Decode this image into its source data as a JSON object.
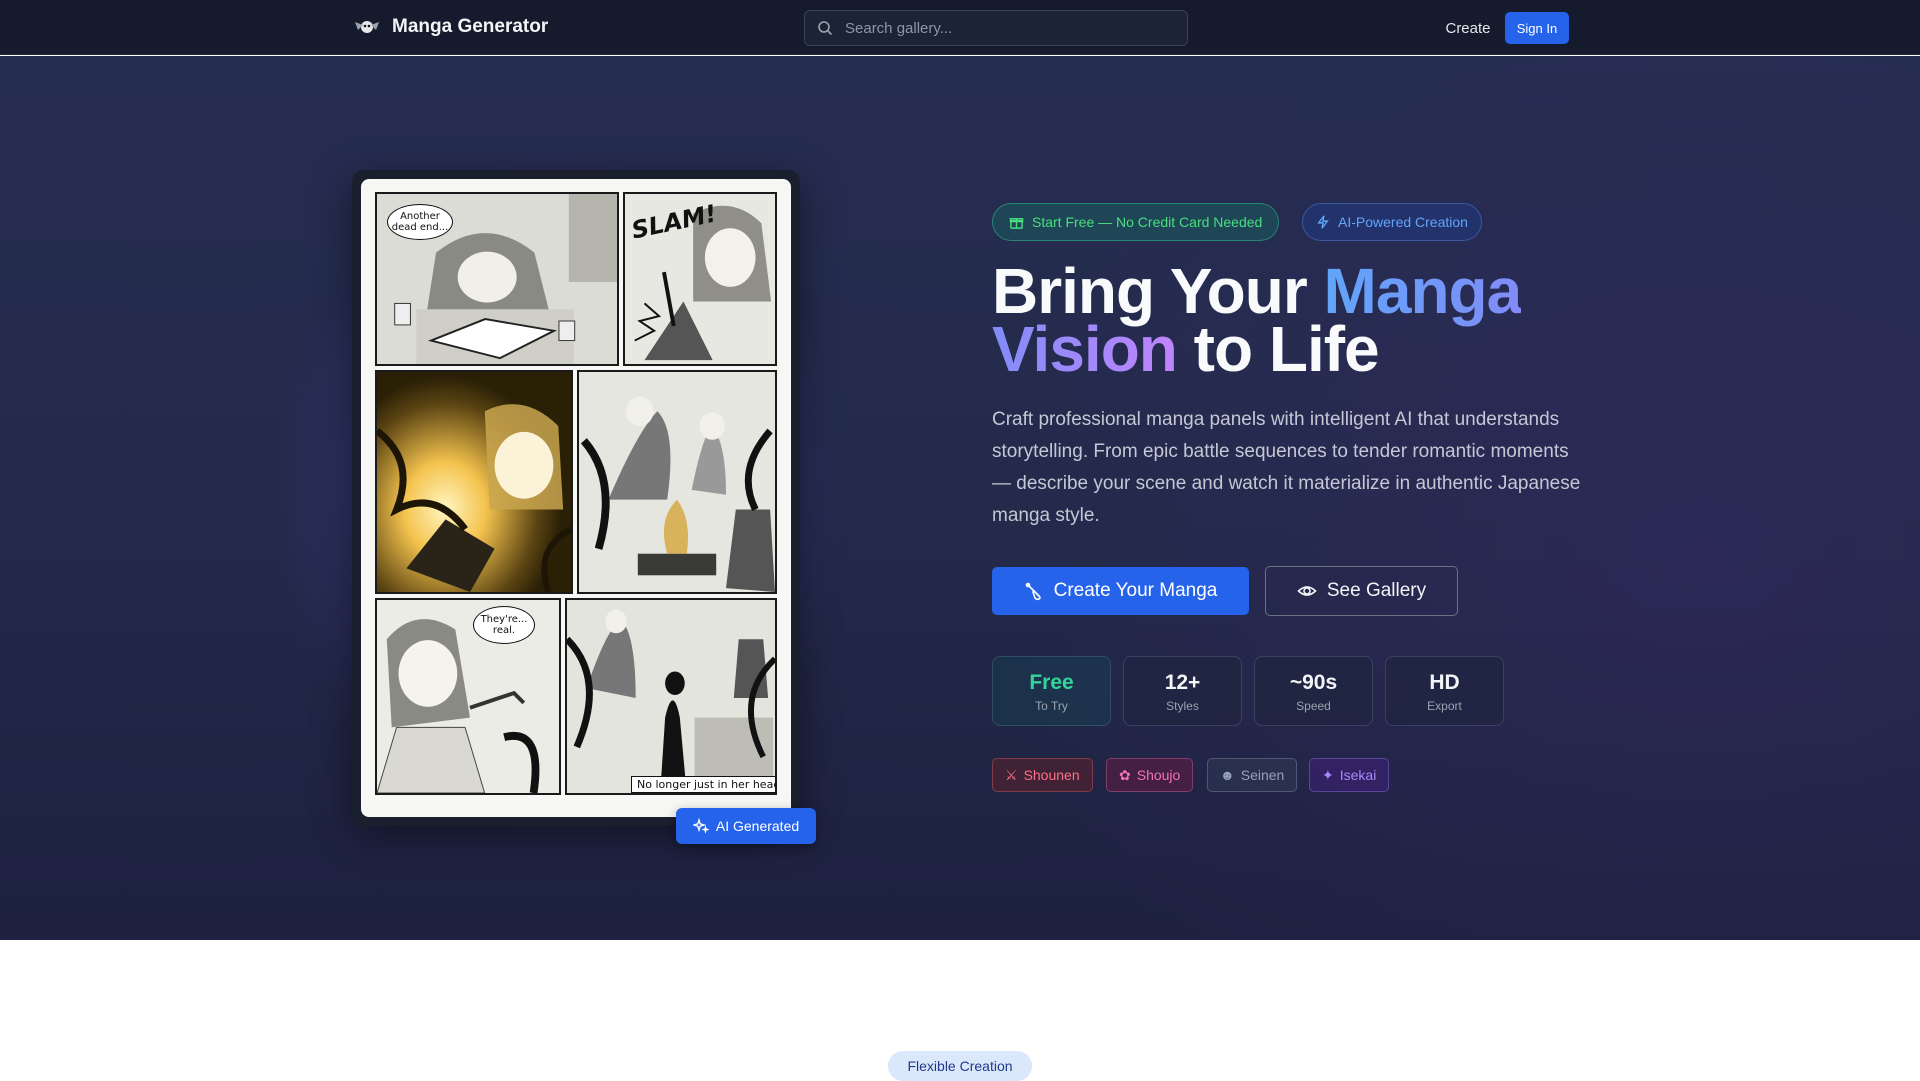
{
  "app": {
    "name": "Manga Generator"
  },
  "nav": {
    "search_placeholder": "Search gallery...",
    "create_label": "Create",
    "signin_label": "Sign In"
  },
  "hero": {
    "pill_free": "Start Free — No Credit Card Needed",
    "pill_ai": "AI-Powered Creation",
    "headline": {
      "part1": "Bring Your ",
      "accent1": "Manga",
      "accent2": "Vision",
      "part2": " to Life"
    },
    "description": "Craft professional manga panels with intelligent AI that understands storytelling. From epic battle sequences to tender romantic moments — describe your scene and watch it materialize in authentic Japanese manga style.",
    "primary_button": "Create Your Manga",
    "secondary_button": "See Gallery",
    "stats": [
      {
        "value": "Free",
        "label": "To Try"
      },
      {
        "value": "12+",
        "label": "Styles"
      },
      {
        "value": "~90s",
        "label": "Speed"
      },
      {
        "value": "HD",
        "label": "Export"
      }
    ],
    "tags": [
      {
        "label": "Shounen",
        "icon": "crossed-swords-icon"
      },
      {
        "label": "Shoujo",
        "icon": "cherry-blossom-icon"
      },
      {
        "label": "Seinen",
        "icon": "theater-masks-icon"
      },
      {
        "label": "Isekai",
        "icon": "sparkles-icon"
      }
    ],
    "ai_badge": "AI Generated",
    "comic": {
      "bubble1": "Another dead end...",
      "sfx": "SLAM!",
      "bubble2": "They're... real.",
      "caption": "No longer just in her head."
    }
  },
  "section": {
    "pill": "Flexible Creation"
  },
  "colors": {
    "accent": "#2563eb",
    "nav_bg": "#151b2c",
    "free_green": "#34d399"
  }
}
